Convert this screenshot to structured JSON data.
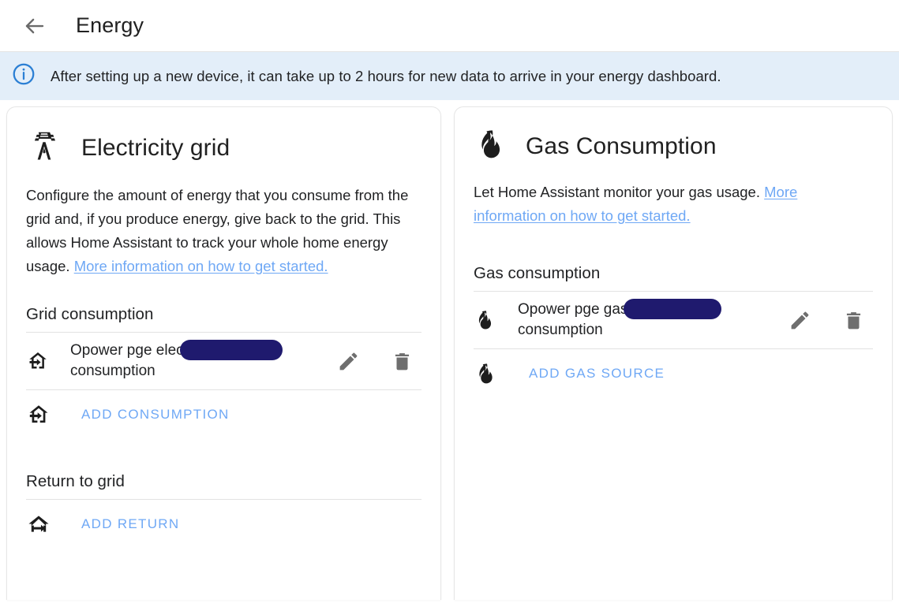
{
  "appbar": {
    "back_icon": "arrow-left-icon",
    "title": "Energy"
  },
  "banner": {
    "icon": "info-circle-icon",
    "text": "After setting up a new device, it can take up to 2 hours for new data to arrive in your energy dashboard.",
    "background_color": "#e3eef9"
  },
  "colors": {
    "link": "#6fa8f5",
    "accent": "#6fa8f5",
    "redaction": "#1f1a6e",
    "text": "#222325",
    "divider": "#e2e2e2"
  },
  "cards": {
    "electricity": {
      "icon": "transmission-tower-icon",
      "title": "Electricity grid",
      "description_before_link": "Configure the amount of energy that you consume from the grid and, if you produce energy, give back to the grid. This allows Home Assistant to track your whole home energy usage. ",
      "description_link": "More information on how to get started.",
      "sections": [
        {
          "title": "Grid consumption",
          "rows": [
            {
              "icon": "home-import-outline-icon",
              "name_before_redaction": "Opower pge elec",
              "redaction_width": 130,
              "name_after_redaction": "consumption",
              "edit_icon": "pencil-icon",
              "delete_icon": "trash-icon"
            }
          ],
          "add_icon": "home-import-outline-icon",
          "add_label": "ADD CONSUMPTION"
        },
        {
          "title": "Return to grid",
          "rows": [],
          "add_icon": "home-export-outline-icon",
          "add_label": "ADD RETURN"
        }
      ]
    },
    "gas": {
      "icon": "fire-icon",
      "title": "Gas Consumption",
      "description_before_link": "Let Home Assistant monitor your gas usage. ",
      "description_link": "More information on how to get started.",
      "sections": [
        {
          "title": "Gas consumption",
          "rows": [
            {
              "icon": "fire-icon",
              "name_before_redaction": "Opower pge gas",
              "redaction_width": 124,
              "name_after_redaction": "consumption",
              "edit_icon": "pencil-icon",
              "delete_icon": "trash-icon"
            }
          ],
          "add_icon": "fire-icon",
          "add_label": "ADD GAS SOURCE"
        }
      ]
    }
  }
}
